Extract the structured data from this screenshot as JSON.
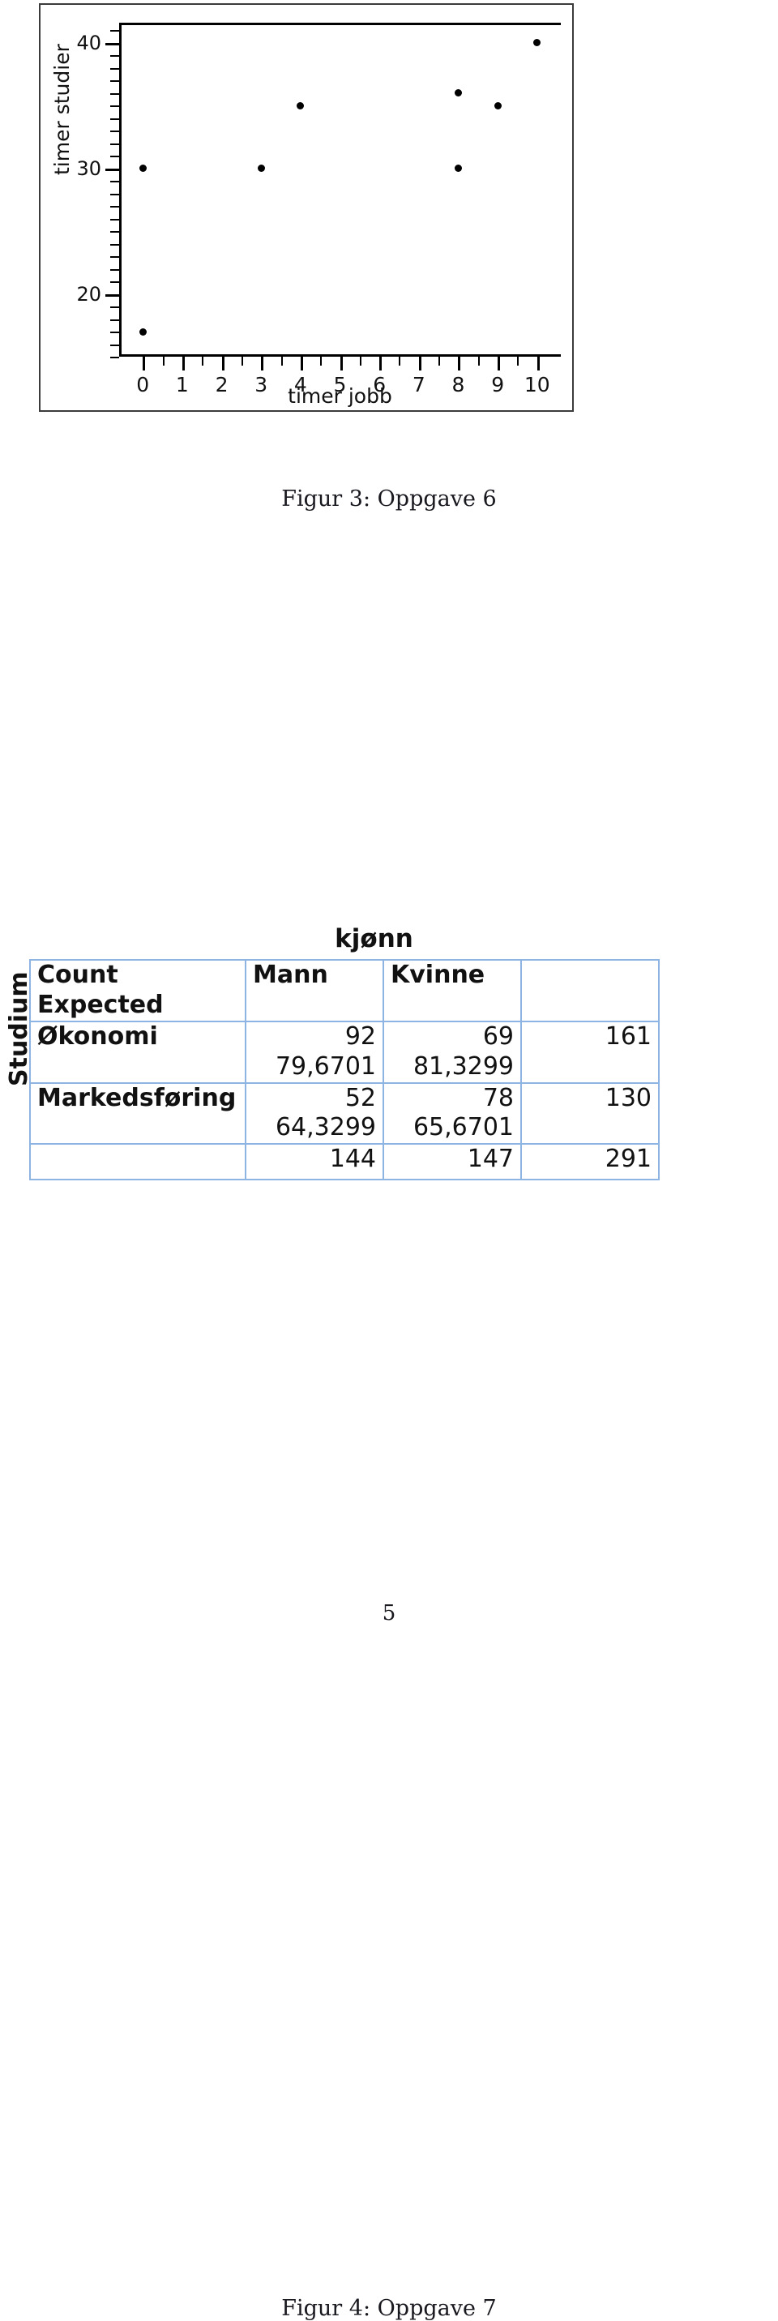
{
  "chart_data": {
    "type": "scatter",
    "title": "",
    "xlabel": "timer jobb",
    "ylabel": "timer studier",
    "xlim": [
      -0.6,
      10.6
    ],
    "ylim": [
      15.0,
      41.6
    ],
    "xticks": [
      0,
      1,
      2,
      3,
      4,
      5,
      6,
      7,
      8,
      9,
      10
    ],
    "xticklabels": [
      "0",
      "1",
      "2",
      "3",
      "4",
      "5",
      "6",
      "7",
      "8",
      "9",
      "10"
    ],
    "yticks": [
      20,
      30,
      40
    ],
    "yticklabels": [
      "20",
      "30",
      "40"
    ],
    "grid": false,
    "legend": "none",
    "points": [
      {
        "x": 0,
        "y": 30
      },
      {
        "x": 0,
        "y": 17
      },
      {
        "x": 3,
        "y": 30
      },
      {
        "x": 4,
        "y": 35
      },
      {
        "x": 8,
        "y": 30
      },
      {
        "x": 8,
        "y": 36
      },
      {
        "x": 9,
        "y": 35
      },
      {
        "x": 10,
        "y": 40
      }
    ]
  },
  "figure3": {
    "caption": "Figur 3: Oppgave 6"
  },
  "figure4": {
    "caption": "Figur 4: Oppgave 7",
    "row_group_label": "Studium",
    "column_group_label": "kjønn",
    "header": {
      "corner_line1": "Count",
      "corner_line2": "Expected",
      "col1": "Mann",
      "col2": "Kvinne",
      "col_total": ""
    },
    "rows": [
      {
        "label": "Økonomi",
        "count_mann": "92",
        "expected_mann": "79,6701",
        "count_kvinne": "69",
        "expected_kvinne": "81,3299",
        "total": "161"
      },
      {
        "label": "Markedsføring",
        "count_mann": "52",
        "expected_mann": "64,3299",
        "count_kvinne": "78",
        "expected_kvinne": "65,6701",
        "total": "130"
      }
    ],
    "totals": {
      "label": "",
      "mann": "144",
      "kvinne": "147",
      "total": "291"
    }
  },
  "page": {
    "number": "5"
  }
}
